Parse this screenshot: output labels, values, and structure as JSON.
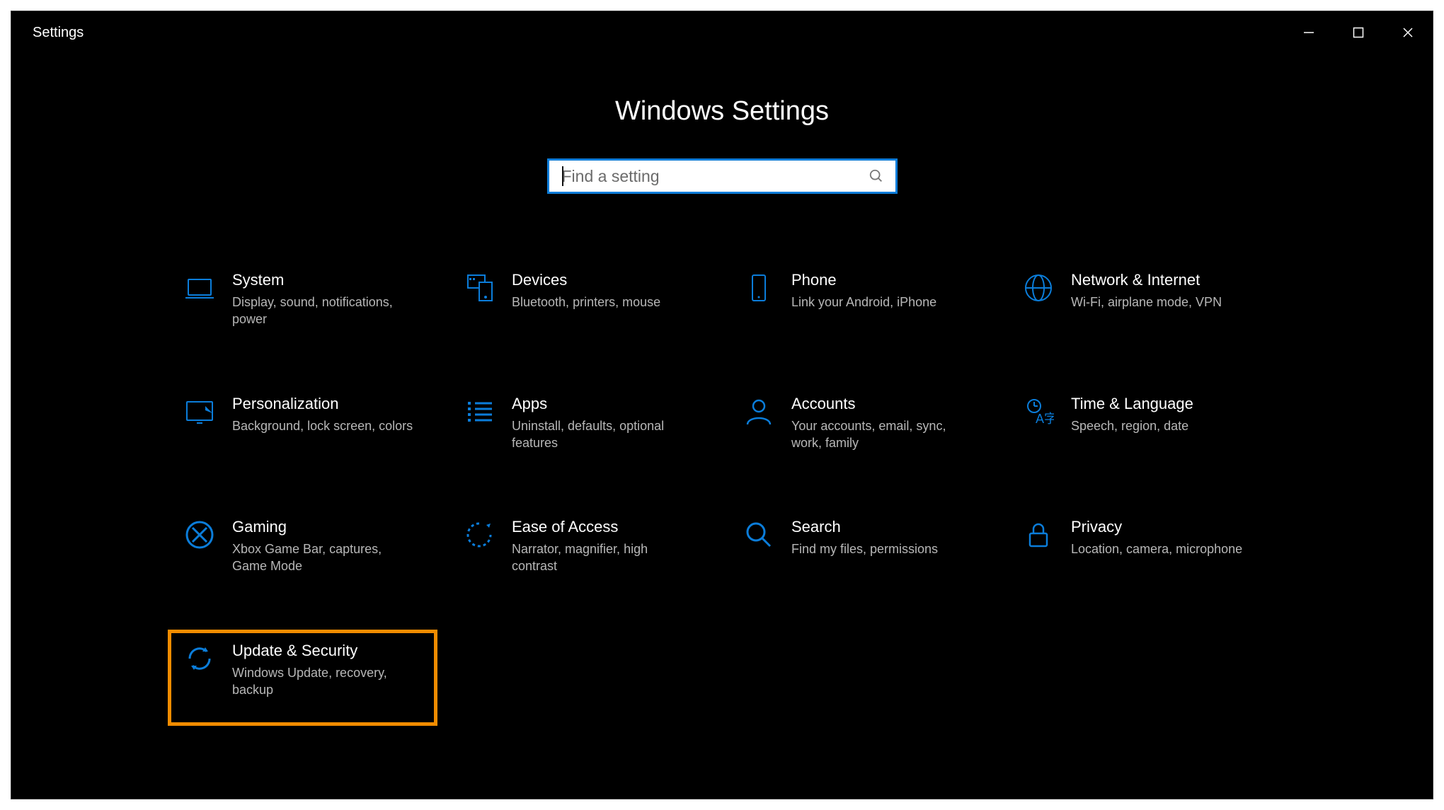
{
  "window": {
    "title": "Settings"
  },
  "header": {
    "page_title": "Windows Settings"
  },
  "search": {
    "placeholder": "Find a setting"
  },
  "accent_color": "#0b7dda",
  "highlight_color": "#f28c00",
  "tiles": [
    {
      "icon": "system",
      "name": "System",
      "desc": "Display, sound, notifications, power"
    },
    {
      "icon": "devices",
      "name": "Devices",
      "desc": "Bluetooth, printers, mouse"
    },
    {
      "icon": "phone",
      "name": "Phone",
      "desc": "Link your Android, iPhone"
    },
    {
      "icon": "network",
      "name": "Network & Internet",
      "desc": "Wi-Fi, airplane mode, VPN"
    },
    {
      "icon": "personalization",
      "name": "Personalization",
      "desc": "Background, lock screen, colors"
    },
    {
      "icon": "apps",
      "name": "Apps",
      "desc": "Uninstall, defaults, optional features"
    },
    {
      "icon": "accounts",
      "name": "Accounts",
      "desc": "Your accounts, email, sync, work, family"
    },
    {
      "icon": "time",
      "name": "Time & Language",
      "desc": "Speech, region, date"
    },
    {
      "icon": "gaming",
      "name": "Gaming",
      "desc": "Xbox Game Bar, captures, Game Mode"
    },
    {
      "icon": "ease",
      "name": "Ease of Access",
      "desc": "Narrator, magnifier, high contrast"
    },
    {
      "icon": "search",
      "name": "Search",
      "desc": "Find my files, permissions"
    },
    {
      "icon": "privacy",
      "name": "Privacy",
      "desc": "Location, camera, microphone"
    },
    {
      "icon": "update",
      "name": "Update & Security",
      "desc": "Windows Update, recovery, backup",
      "highlight": true
    }
  ]
}
